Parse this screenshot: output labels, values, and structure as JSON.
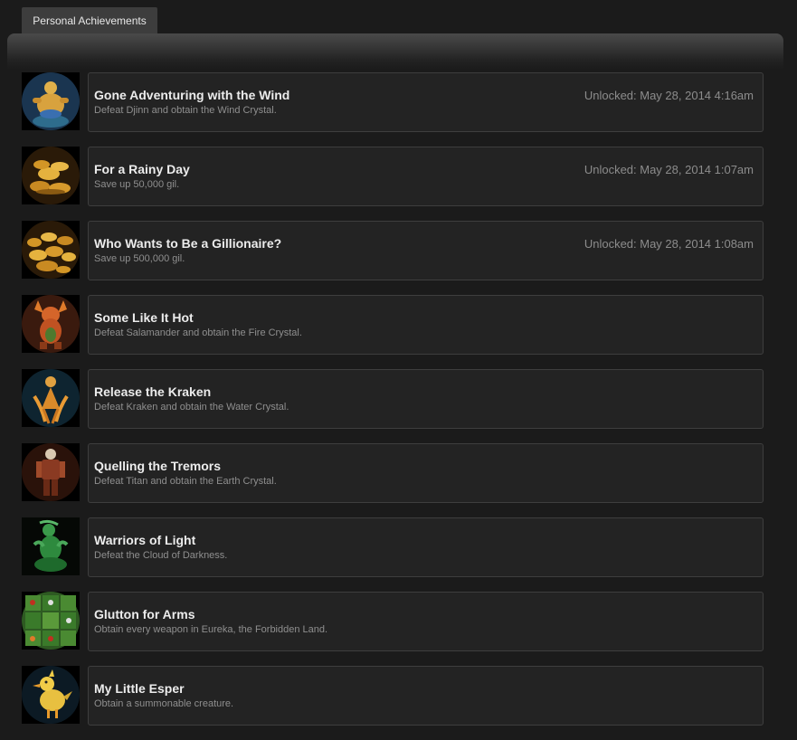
{
  "tab": {
    "label": "Personal Achievements"
  },
  "achievements": [
    {
      "title": "Gone Adventuring with the Wind",
      "description": "Defeat Djinn and obtain the Wind Crystal.",
      "unlocked": "Unlocked: May 28, 2014 4:16am",
      "icon": "djinn-icon"
    },
    {
      "title": "For a Rainy Day",
      "description": "Save up 50,000 gil.",
      "unlocked": "Unlocked: May 28, 2014 1:07am",
      "icon": "gil-coins-icon"
    },
    {
      "title": "Who Wants to Be a Gillionaire?",
      "description": "Save up 500,000 gil.",
      "unlocked": "Unlocked: May 28, 2014 1:08am",
      "icon": "gil-pile-icon"
    },
    {
      "title": "Some Like It Hot",
      "description": "Defeat Salamander and obtain the Fire Crystal.",
      "unlocked": "",
      "icon": "salamander-icon"
    },
    {
      "title": "Release the Kraken",
      "description": "Defeat Kraken and obtain the Water Crystal.",
      "unlocked": "",
      "icon": "kraken-icon"
    },
    {
      "title": "Quelling the Tremors",
      "description": "Defeat Titan and obtain the Earth Crystal.",
      "unlocked": "",
      "icon": "titan-icon"
    },
    {
      "title": "Warriors of Light",
      "description": "Defeat the Cloud of Darkness.",
      "unlocked": "",
      "icon": "cloud-of-darkness-icon"
    },
    {
      "title": "Glutton for Arms",
      "description": "Obtain every weapon in Eureka, the Forbidden Land.",
      "unlocked": "",
      "icon": "weapons-icon"
    },
    {
      "title": "My Little Esper",
      "description": "Obtain a summonable creature.",
      "unlocked": "",
      "icon": "chocobo-icon"
    }
  ]
}
